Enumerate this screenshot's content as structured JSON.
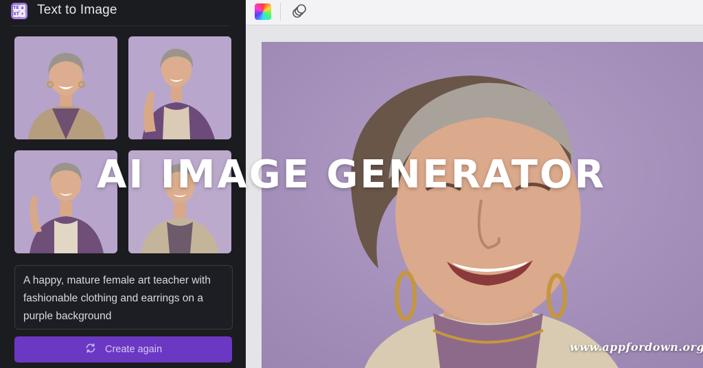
{
  "panel": {
    "title": "Text to Image",
    "icon_cells": [
      "TE",
      "XT",
      "a",
      "+"
    ]
  },
  "thumbnails": [
    {
      "name": "generated-image-1"
    },
    {
      "name": "generated-image-2"
    },
    {
      "name": "generated-image-3"
    },
    {
      "name": "generated-image-4"
    }
  ],
  "prompt": {
    "value": "A happy, mature female art teacher with fashionable clothing and earrings on a purple background"
  },
  "create_button": {
    "label": "Create again",
    "icon": "refresh-icon"
  },
  "toolbar": {
    "icons": [
      "color-picker-icon",
      "transparency-icon"
    ]
  },
  "overlay": {
    "title": "AI IMAGE GENERATOR",
    "watermark": "www.appfordown.org"
  },
  "colors": {
    "panel_bg": "#1b1c20",
    "accent": "#6b38c4",
    "image_bg": "#a892bd"
  }
}
